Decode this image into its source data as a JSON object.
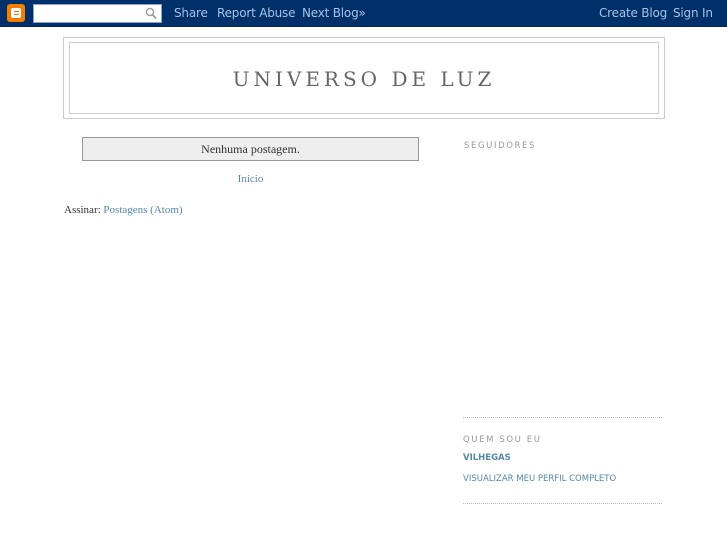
{
  "navbar": {
    "logo_icon": "blogger-logo-icon",
    "search": {
      "value": "",
      "placeholder": "",
      "icon": "search-icon"
    },
    "left_links": [
      "Share",
      "Report Abuse",
      "Next Blog»"
    ],
    "right_links": [
      "Create Blog",
      "Sign In"
    ],
    "background_color": "#00306a",
    "link_color": "#a7c2e5",
    "logo_color": "#f57d00"
  },
  "header": {
    "title": "UNIVERSO DE LUZ"
  },
  "main": {
    "status_message": "Nenhuma postagem.",
    "home_link": "Início",
    "subscribe_label": "Assinar:",
    "subscribe_link": "Postagens (Atom)",
    "link_color": "#5588aa"
  },
  "sidebar": {
    "followers_heading": "SEGUIDORES",
    "about_heading": "QUEM SOU EU",
    "profile_name": "VILHEGAS",
    "profile_link": "VISUALIZAR MEU PERFIL COMPLETO"
  }
}
